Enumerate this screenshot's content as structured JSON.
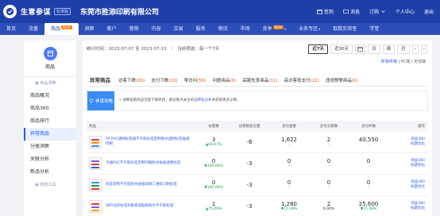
{
  "header": {
    "brand": "生意参谋",
    "brand_tag": "标准版",
    "company": "东莞市胜添印刷有限公司",
    "actions": [
      "签到",
      "消息",
      "订购",
      "个人中心",
      "退出"
    ]
  },
  "nav": {
    "items": [
      {
        "label": "首页"
      },
      {
        "label": "流量"
      },
      {
        "label": "商品",
        "new": "NEW",
        "active": true
      },
      {
        "label": "洞察"
      },
      {
        "label": "客户"
      },
      {
        "label": "营销"
      },
      {
        "label": "内容"
      },
      {
        "label": "交易"
      },
      {
        "label": "服务"
      },
      {
        "label": "物流"
      },
      {
        "label": "市场"
      },
      {
        "label": "竞争",
        "new": "NEW",
        "dropdown": true
      },
      {
        "label": "业务专区",
        "dropdown": true
      },
      {
        "label": "取数实验室"
      },
      {
        "label": "学堂"
      }
    ],
    "new_badge": "NEW"
  },
  "sidebar": {
    "title": "商品",
    "items": [
      {
        "label": "▣ 商品洞察",
        "type": "sub"
      },
      {
        "label": "商品概况"
      },
      {
        "label": "商品360",
        "tag": "NEW"
      },
      {
        "label": "商品排行"
      },
      {
        "label": "异常商品",
        "active": true
      },
      {
        "label": "分类洞察"
      },
      {
        "label": "关联分析"
      },
      {
        "label": "新品分析"
      },
      {
        "label": "▣ 物流工具",
        "type": "sub"
      }
    ]
  },
  "main": {
    "stat_time": "统计时间：2023-07-07 至 2023-07-13",
    "stat_note": "当前筛选：每一个7天",
    "period_buttons": [
      "近7天",
      "近30天",
      "日",
      "周",
      "月"
    ],
    "subline_prefix": "所有终端",
    "subline_rest": "| PC端 | 无线端",
    "tabs": [
      {
        "label": "异常商品",
        "first": true
      },
      {
        "label": "访客下跌",
        "count": "(26)"
      },
      {
        "label": "支付下跌",
        "count": "(10)"
      },
      {
        "label": "零访问",
        "count": "(59)"
      },
      {
        "label": "问题商品",
        "count": "(0)"
      },
      {
        "label": "高跳失率商品",
        "count": "(11)"
      },
      {
        "label": "高访客低支付",
        "count": "(22)"
      },
      {
        "label": "违规预警商品",
        "count": "(0)"
      }
    ],
    "advice": {
      "tag": "参谋攻略",
      "text_prefix": "• 详细查看商品流量下降原因，建议重点关注单品",
      "link": "转化分析",
      "text_suffix": "并获取更多诊断。"
    },
    "table": {
      "headers": [
        "商品",
        "访客数",
        "访客数变化量",
        "支付金额",
        "支付买家数",
        "支付件数",
        "操作"
      ],
      "rows": [
        {
          "name": "PP PVC透明标签纸不干胶标签定制防水透明标签贴纸印刷",
          "visitors": "3",
          "visitors_chg": "▲66.67%",
          "delta": "-6",
          "amount": "1,622",
          "amount_chg": "-",
          "buyers": "2",
          "buyers_chg": "-",
          "qty": "40,550",
          "qty_chg": "-",
          "op1": "商品360",
          "op2": "标题优化",
          "thumb_colors": [
            "#e33",
            "#f90",
            "#3a8cf5"
          ]
        },
        {
          "name": "卡通PVC不干胶标签定制印刷防水贴纸透明标签",
          "visitors": "0",
          "visitors_chg": "▼100.00%",
          "delta": "-3",
          "amount": "0",
          "amount_chg": "-",
          "buyers": "0",
          "buyers_chg": "-",
          "qty": "0",
          "qty_chg": "-",
          "op1": "商品360",
          "op2": "标题优化",
          "thumb_colors": [
            "#7a5ae0",
            "#e33",
            "#2b5ae0"
          ]
        },
        {
          "name": "标签定制不干胶防水贴纸印刷二维码订制标签",
          "visitors": "0",
          "visitors_chg": "▼100.00%",
          "delta": "-3",
          "amount": "0",
          "amount_chg": "-",
          "buyers": "0",
          "buyers_chg": "-",
          "qty": "0",
          "qty_chg": "-",
          "op1": "商品360",
          "op2": "标题优化",
          "thumb_colors": [
            "#3a8cf5",
            "#16a34a",
            "#e33"
          ]
        },
        {
          "name": "SMT过炉标签PI耐高温贴纸防水不干胶标签",
          "visitors": "1",
          "visitors_chg": "▲75.00%",
          "delta": "-3",
          "amount": "1,280",
          "amount_chg": "▼15.28%",
          "buyers": "2",
          "buyers_chg": "0.00%",
          "qty": "25,600",
          "qty_chg": "▼15.28%",
          "op1": "商品360",
          "op2": "标题优化",
          "thumb_colors": [
            "#e33",
            "#7a5ae0",
            "#f90"
          ]
        }
      ]
    }
  },
  "colors": {
    "header_bg": "#1f3fa8",
    "nav_bg": "#2d4eb8",
    "accent": "#2b5ae0",
    "positive": "#16a34a",
    "tab_count": "#e0561b",
    "new_tag": "#ff7a00"
  }
}
